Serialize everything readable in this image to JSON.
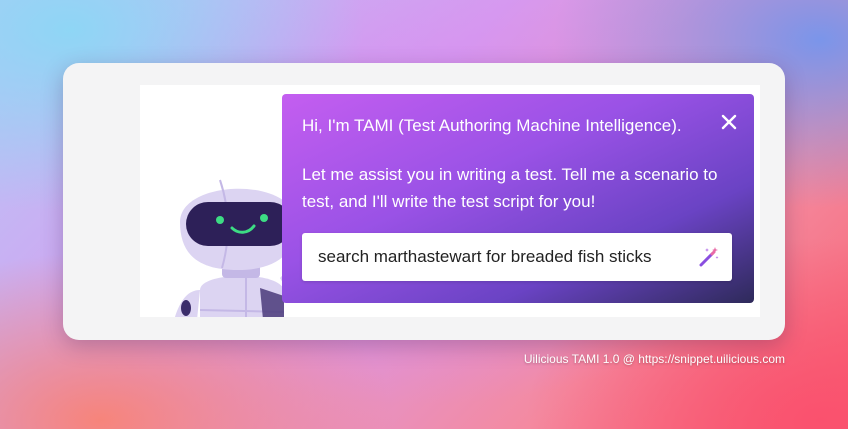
{
  "dialog": {
    "greeting": "Hi, I'm TAMI (Test Authoring Machine Intelligence).",
    "message": "Let me assist you in writing a test. Tell me a scenario to test, and I'll write the test script for you!",
    "input_value": "search marthastewart for breaded fish sticks",
    "close_icon": "close-icon",
    "wand_icon": "magic-wand-icon"
  },
  "mascot": {
    "icon": "robot-mascot"
  },
  "footer": {
    "caption": "Uilicious TAMI 1.0 @ https://snippet.uilicious.com"
  },
  "colors": {
    "panel_gradient_start": "#c45ef0",
    "panel_gradient_mid": "#6a43c4",
    "panel_gradient_end": "#2e2a5a",
    "robot_body": "#dcd4f2",
    "robot_visor": "#2d2058",
    "robot_eyes": "#3ddc84"
  }
}
